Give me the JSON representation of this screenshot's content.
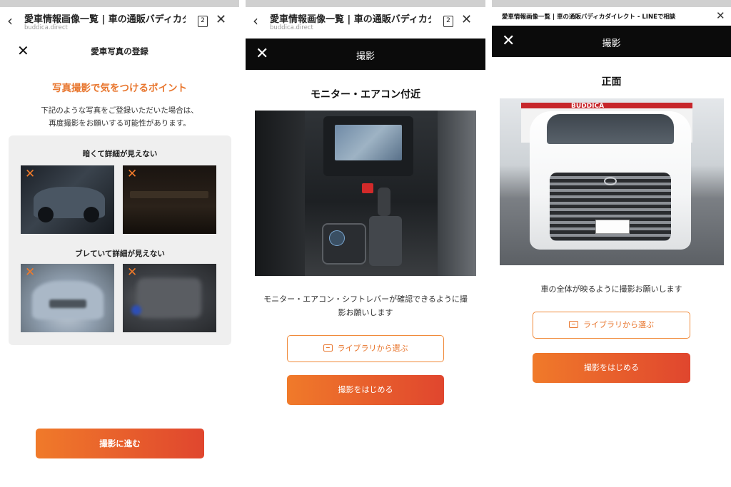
{
  "screen1": {
    "browser": {
      "back_icon": "chevron-left-icon",
      "title": "愛車情報画像一覧 | 車の通販バディカダ...",
      "domain": "buddica.direct",
      "tab_count": "2",
      "close_icon": "close-icon"
    },
    "header": {
      "title": "愛車写真の登録"
    },
    "point_heading": "写真撮影で気をつけるポイント",
    "description": [
      "下記のような写真をご登録いただいた場合は、",
      "再度撮影をお願いする可能性があります。"
    ],
    "sections": [
      {
        "label": "暗くて詳細が見えない"
      },
      {
        "label": "ブレていて詳細が見えない"
      }
    ],
    "ng_mark": "✕",
    "proceed_button": "撮影に進む"
  },
  "screen2": {
    "browser": {
      "title": "愛車情報画像一覧 | 車の通販バディカダ...",
      "domain": "buddica.direct",
      "tab_count": "2"
    },
    "header": {
      "title": "撮影"
    },
    "shot_title": "モニター・エアコン付近",
    "caption": [
      "モニター・エアコン・シフトレバーが確認できるように撮",
      "影お願いします"
    ],
    "library_button": "ライブラリから選ぶ",
    "start_button": "撮影をはじめる"
  },
  "screen3": {
    "top_title": "愛車情報画像一覧 | 車の通販バディカダイレクト - LINEで相談",
    "header": {
      "title": "撮影"
    },
    "shot_title": "正面",
    "caption": "車の全体が映るように撮影お願いします",
    "library_button": "ライブラリから選ぶ",
    "start_button": "撮影をはじめる",
    "photo_sign_text": "BUDDICA"
  },
  "colors": {
    "accent_orange": "#f07a2a",
    "accent_red": "#e0462e",
    "header_black": "#0b0b0b",
    "panel_gray": "#efefef"
  }
}
